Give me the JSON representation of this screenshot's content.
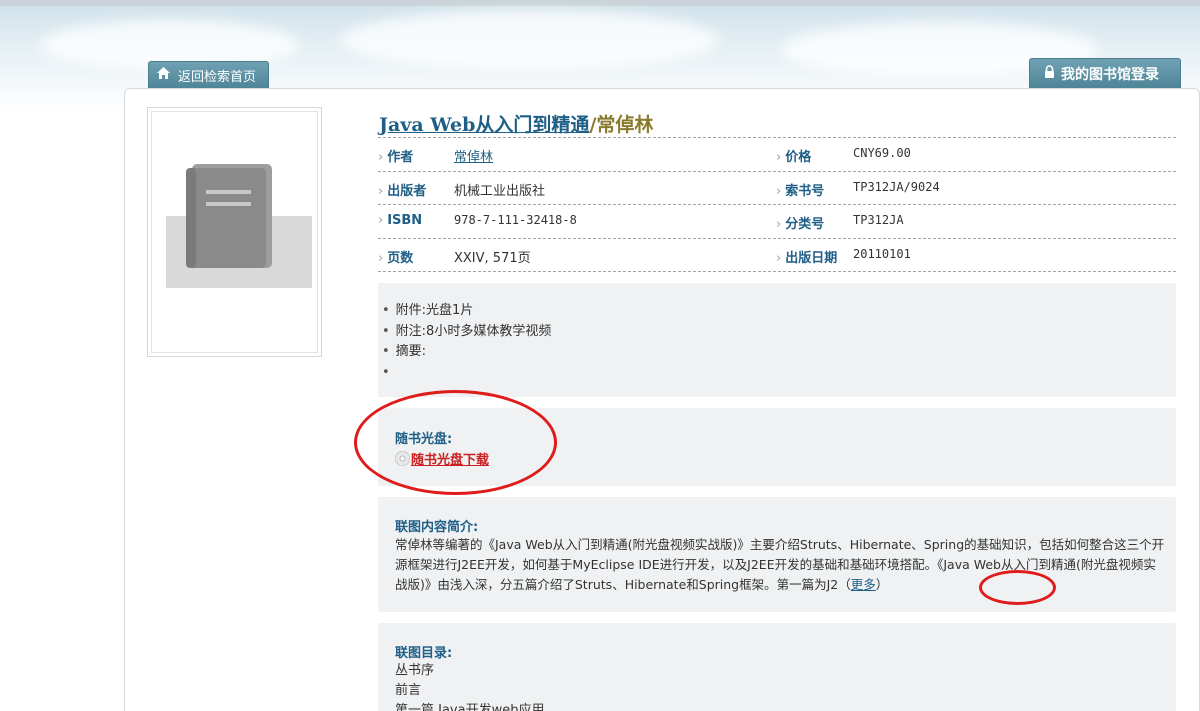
{
  "header": {
    "back_tab": "返回检索首页",
    "login_tab": "我的图书馆登录"
  },
  "book": {
    "title": "Java Web从入门到精通",
    "author_suffix": "/常倬林"
  },
  "info": {
    "author_label": "作者",
    "author_value": "常倬林",
    "price_label": "价格",
    "price_value": "CNY69.00",
    "publisher_label": "出版者",
    "publisher_value": "机械工业出版社",
    "callno_label": "索书号",
    "callno_value": "TP312JA/9024",
    "isbn_label": "ISBN",
    "isbn_value": "978-7-111-32418-8",
    "class_label": "分类号",
    "class_value": "TP312JA",
    "pages_label": "页数",
    "pages_value": "XXIV, 571页",
    "pubdate_label": "出版日期",
    "pubdate_value": "20110101"
  },
  "notes": [
    "附件:光盘1片",
    "附注:8小时多媒体教学视频",
    "摘要:",
    ""
  ],
  "disc": {
    "title": "随书光盘:",
    "link": "随书光盘下载"
  },
  "summary": {
    "title": "联图内容简介:",
    "text": "常倬林等编著的《Java Web从入门到精通(附光盘视频实战版)》主要介绍Struts、Hibernate、Spring的基础知识，包括如何整合这三个开源框架进行J2EE开发，如何基于MyEclipse IDE进行开发，以及J2EE开发的基础和基础环境搭配。《Java Web从入门到精通(附光盘视频实战版)》由浅入深，分五篇介绍了Struts、Hibernate和Spring框架。第一篇为J2",
    "more_open": "（",
    "more": "更多",
    "more_close": "）"
  },
  "toc": {
    "title": "联图目录:",
    "items": [
      "丛书序",
      "前言",
      "第一篇 Java开发web应用"
    ]
  },
  "colors": {
    "tab_bg": "#5b8fa2",
    "link_blue": "#1f5f86",
    "annotation_red": "#e01b1b",
    "box_bg": "#eff1f3"
  }
}
